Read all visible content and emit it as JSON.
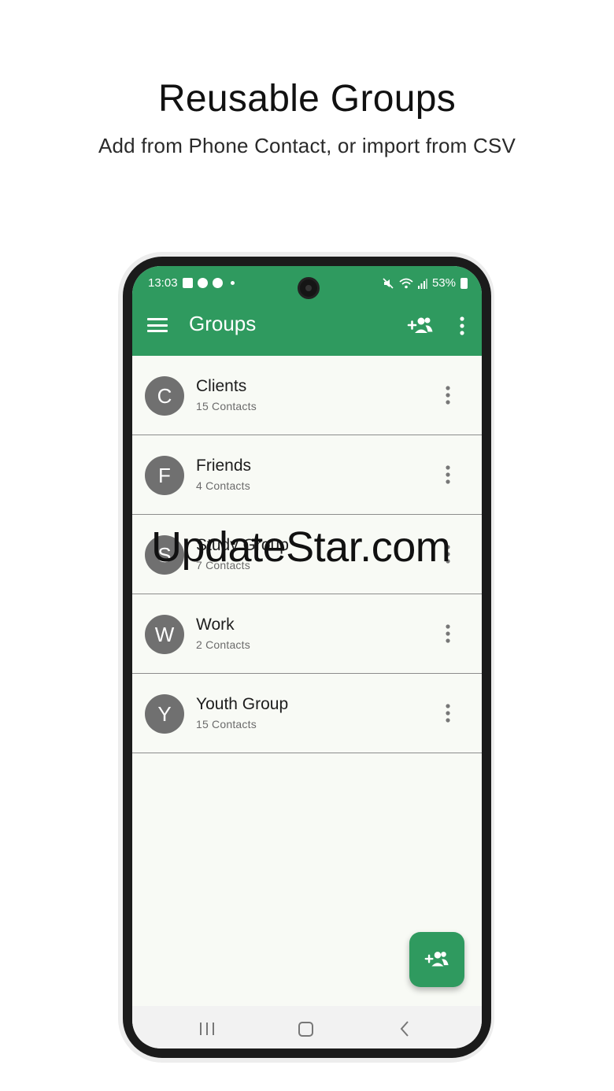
{
  "headline": {
    "title": "Reusable Groups",
    "subtitle": "Add from Phone Contact, or import from CSV"
  },
  "status_bar": {
    "time": "13:03",
    "battery": "53%"
  },
  "toolbar": {
    "title": "Groups",
    "icons": [
      "menu-icon",
      "add-group-icon",
      "more-vert-icon"
    ]
  },
  "groups": [
    {
      "initial": "C",
      "name": "Clients",
      "count": "15 Contacts"
    },
    {
      "initial": "F",
      "name": "Friends",
      "count": "4 Contacts"
    },
    {
      "initial": "S",
      "name": "Study Group",
      "count": "7 Contacts"
    },
    {
      "initial": "W",
      "name": "Work",
      "count": "2 Contacts"
    },
    {
      "initial": "Y",
      "name": "Youth Group",
      "count": "15 Contacts"
    }
  ],
  "fab": {
    "icon": "add-group-icon"
  },
  "watermark": "UpdateStar.com",
  "colors": {
    "primary": "#2f9a5f",
    "background": "#f8faf5",
    "avatar": "#707070"
  }
}
